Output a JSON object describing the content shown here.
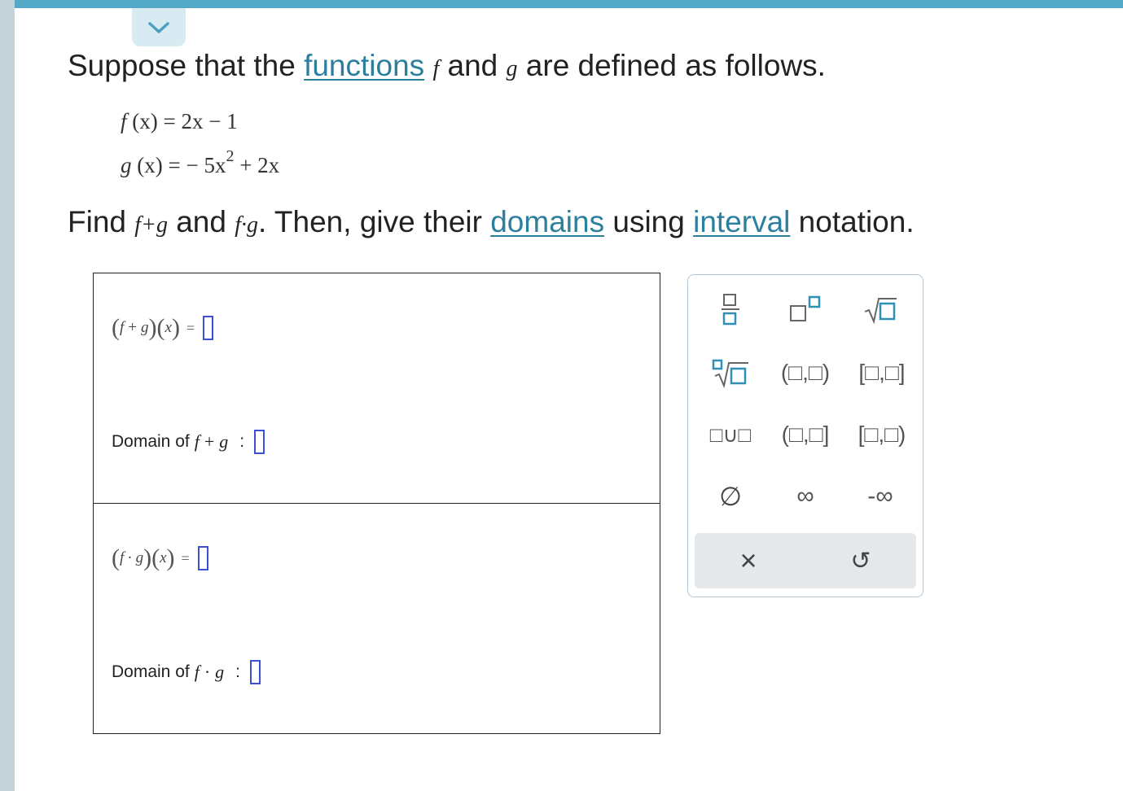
{
  "question": {
    "line1_pre": "Suppose that the ",
    "line1_link": "functions",
    "line1_f": "f",
    "line1_and": " and ",
    "line1_g": "g",
    "line1_post": " are defined as follows.",
    "def_f_lhs": "f",
    "def_f_arg": "(x)",
    "def_f_rhs": "= 2x − 1",
    "def_g_lhs": "g",
    "def_g_arg": "(x)",
    "def_g_rhs_a": "= − 5x",
    "def_g_exp": "2",
    "def_g_rhs_b": " + 2x",
    "line2_find": "Find ",
    "line2_sum": "f+g",
    "line2_and": " and ",
    "line2_prod": "f·g",
    "line2_mid": ". Then, give their ",
    "line2_link1": "domains",
    "line2_using": " using ",
    "line2_link2": "interval",
    "line2_post": " notation."
  },
  "answers": {
    "sum_f": "f",
    "sum_op": "+",
    "sum_g": "g",
    "sum_x": "x",
    "eq": "=",
    "domain_label": "Domain of ",
    "domain_sum_f": "f",
    "domain_sum_op": "+",
    "domain_sum_g": "g",
    "domain_colon": ":",
    "prod_f": "f",
    "prod_op": "·",
    "prod_g": "g",
    "prod_x": "x",
    "domain_prod_f": "f",
    "domain_prod_op": "·",
    "domain_prod_g": "g"
  },
  "keypad": {
    "open_open": "(□,□)",
    "closed_closed": "[□,□]",
    "open_closed": "(□,□]",
    "closed_open": "[□,□)",
    "union": "□∪□",
    "empty_set": "∅",
    "infinity": "∞",
    "neg_infinity": "-∞",
    "clear": "×",
    "undo": "↺"
  },
  "colors": {
    "accent": "#55a9c8",
    "link": "#2d7f9e",
    "input_border": "#3b4fd8",
    "keypad_box": "#2f8fb5"
  }
}
